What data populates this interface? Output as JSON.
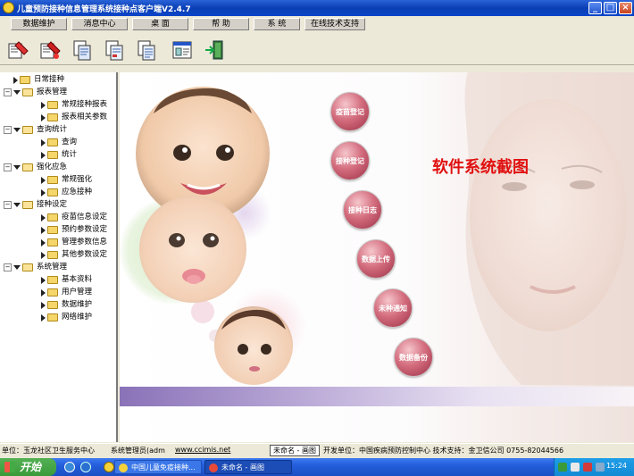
{
  "window": {
    "title": "儿童预防接种信息管理系统接种点客户端V2.4.7",
    "minimize_label": "_",
    "maximize_label": "□",
    "close_label": "×"
  },
  "menu": [
    {
      "label": "数据维护"
    },
    {
      "label": "消息中心"
    },
    {
      "label": "桌  面"
    },
    {
      "label": "帮  助"
    },
    {
      "label": "系  统"
    },
    {
      "label": "在线技术支持"
    }
  ],
  "toolbar": [
    {
      "icon": "vaccine-register-icon"
    },
    {
      "icon": "inoculation-register-icon"
    },
    {
      "icon": "document-copy-icon"
    },
    {
      "icon": "document-stack-icon"
    },
    {
      "icon": "document-list-icon"
    },
    {
      "icon": "window-panel-icon"
    },
    {
      "icon": "exit-door-icon"
    }
  ],
  "tree": {
    "n0": "日常接种",
    "n1": "报表管理",
    "n2": "常规接种报表",
    "n3": "报表相关参数",
    "n4": "查询统计",
    "n5": "查询",
    "n6": "统计",
    "n7": "强化应急",
    "n8": "常规强化",
    "n9": "应急接种",
    "n10": "接种设定",
    "n11": "疫苗信息设定",
    "n12": "预约参数设定",
    "n13": "管理参数信息",
    "n14": "其他参数设定",
    "n15": "系统管理",
    "n16": "基本资料",
    "n17": "用户管理",
    "n18": "数据维护",
    "n19": "网络维护"
  },
  "main": {
    "buttons": {
      "b0": "疫苗登记",
      "b1": "接种登记",
      "b2": "接种日志",
      "b3": "数据上传",
      "b4": "未种通知",
      "b5": "数据备份"
    },
    "screenshot_label": "软件系统截图",
    "accent_color": "#e01010",
    "button_color": "#b8445a"
  },
  "status": {
    "unit": "单位：玉龙社区卫生服务中心",
    "admin": "系统管理员(adm",
    "website": "www.ccimis.net",
    "untitled": "未命名 - 画图",
    "developer": "开发单位：中国疾病预防控制中心  技术支持：金卫信公司  0755-82044566"
  },
  "taskbar": {
    "start_label": "开始",
    "task1": "中国儿童免疫接种...",
    "task2": "未命名 - 画图",
    "clock": "15:24"
  }
}
